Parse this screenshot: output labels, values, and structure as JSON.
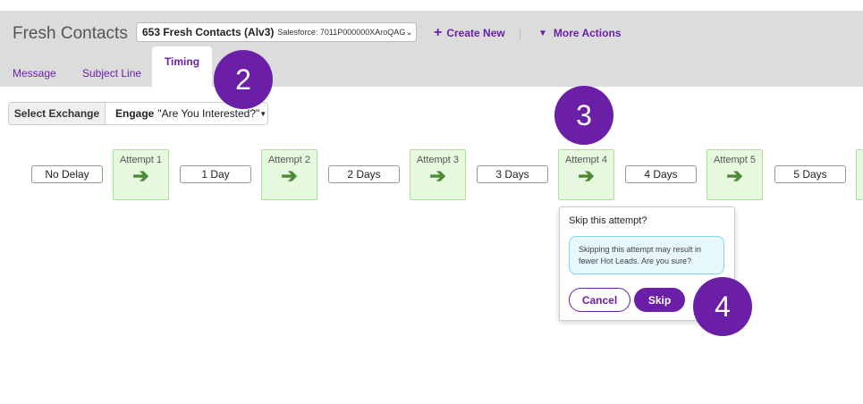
{
  "app": {
    "title": "Fresh Contacts"
  },
  "record_select": {
    "name": "653 Fresh Contacts (Alv3)",
    "source": "Salesforce: 7011P000000XAroQAG",
    "chevron_icon": "chevron-down-icon"
  },
  "actions": {
    "create_new": "Create New",
    "create_new_icon": "+",
    "more_actions": "More Actions",
    "more_actions_icon": "caret-down-icon"
  },
  "tabs": [
    {
      "label": "Message",
      "active": false
    },
    {
      "label": "Subject Line",
      "active": false
    },
    {
      "label": "Timing",
      "active": true
    }
  ],
  "exchange": {
    "label": "Select Exchange",
    "engage_bold": "Engage",
    "engage_value": "\"Are You Interested?\""
  },
  "timeline": {
    "delays": [
      "No Delay",
      "1 Day",
      "2 Days",
      "3 Days",
      "4 Days",
      "5 Days"
    ],
    "attempts": [
      "Attempt 1",
      "Attempt 2",
      "Attempt 3",
      "Attempt 4",
      "Attempt 5"
    ],
    "arrow_glyph": "➔"
  },
  "popover": {
    "title": "Skip this attempt?",
    "warning": "Skipping this attempt may result in fewer Hot Leads. Are you sure?",
    "cancel": "Cancel",
    "skip": "Skip"
  },
  "badges": [
    "2",
    "3",
    "4"
  ],
  "colors": {
    "accent": "#6b1fa6",
    "attempt_bg": "#e6f9df",
    "attempt_border": "#a9e19a",
    "arrow": "#4c8a38",
    "warning_bg": "#e6f7fd",
    "warning_border": "#7ed6f0",
    "topbar": "#dcdcdc"
  }
}
